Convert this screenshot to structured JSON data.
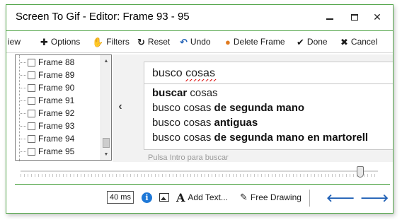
{
  "window": {
    "title": "Screen To Gif - Editor: Frame 93 - 95",
    "min_glyph": "",
    "max_glyph": "",
    "close_glyph": "✕"
  },
  "toolbar": {
    "items": [
      {
        "label": "iew",
        "icon": ""
      },
      {
        "label": "Options",
        "icon": "✚"
      },
      {
        "label": "Filters",
        "icon": "✋"
      },
      {
        "label": "Reset",
        "icon": "↻"
      },
      {
        "label": "Undo",
        "icon": "↶"
      },
      {
        "label": "Delete Frame",
        "icon": "●"
      },
      {
        "label": "Done",
        "icon": "✔"
      },
      {
        "label": "Cancel",
        "icon": "✖"
      }
    ]
  },
  "frames": {
    "items": [
      {
        "label": "Frame  88"
      },
      {
        "label": "Frame  89"
      },
      {
        "label": "Frame  90"
      },
      {
        "label": "Frame  91"
      },
      {
        "label": "Frame  92"
      },
      {
        "label": "Frame  93"
      },
      {
        "label": "Frame  94"
      },
      {
        "label": "Frame  95"
      }
    ],
    "scroll_up": "▲",
    "scroll_down": "▼"
  },
  "preview": {
    "prev_glyph": "‹",
    "search_value": "busco cosas",
    "suggestions": [
      {
        "plain": "",
        "bold": "buscar",
        "rest": " cosas"
      },
      {
        "plain": "busco cosas ",
        "bold": "de segunda mano",
        "rest": ""
      },
      {
        "plain": "busco cosas ",
        "bold": "antiguas",
        "rest": ""
      },
      {
        "plain": "busco cosas ",
        "bold": "de segunda mano en martorell",
        "rest": ""
      }
    ],
    "hint": "Pulsa Intro para buscar"
  },
  "slider": {
    "value_fraction": 0.96
  },
  "bottombar": {
    "delay": "40 ms",
    "info_glyph": "i",
    "add_text": "Add Text...",
    "add_text_glyph": "A",
    "free_drawing": "Free Drawing",
    "free_drawing_glyph": "✎",
    "prev_glyph": "🡐",
    "next_glyph": "🡒"
  },
  "colors": {
    "accent": "#53a64a",
    "info": "#1e78d7",
    "nav": "#1e5fb5"
  }
}
